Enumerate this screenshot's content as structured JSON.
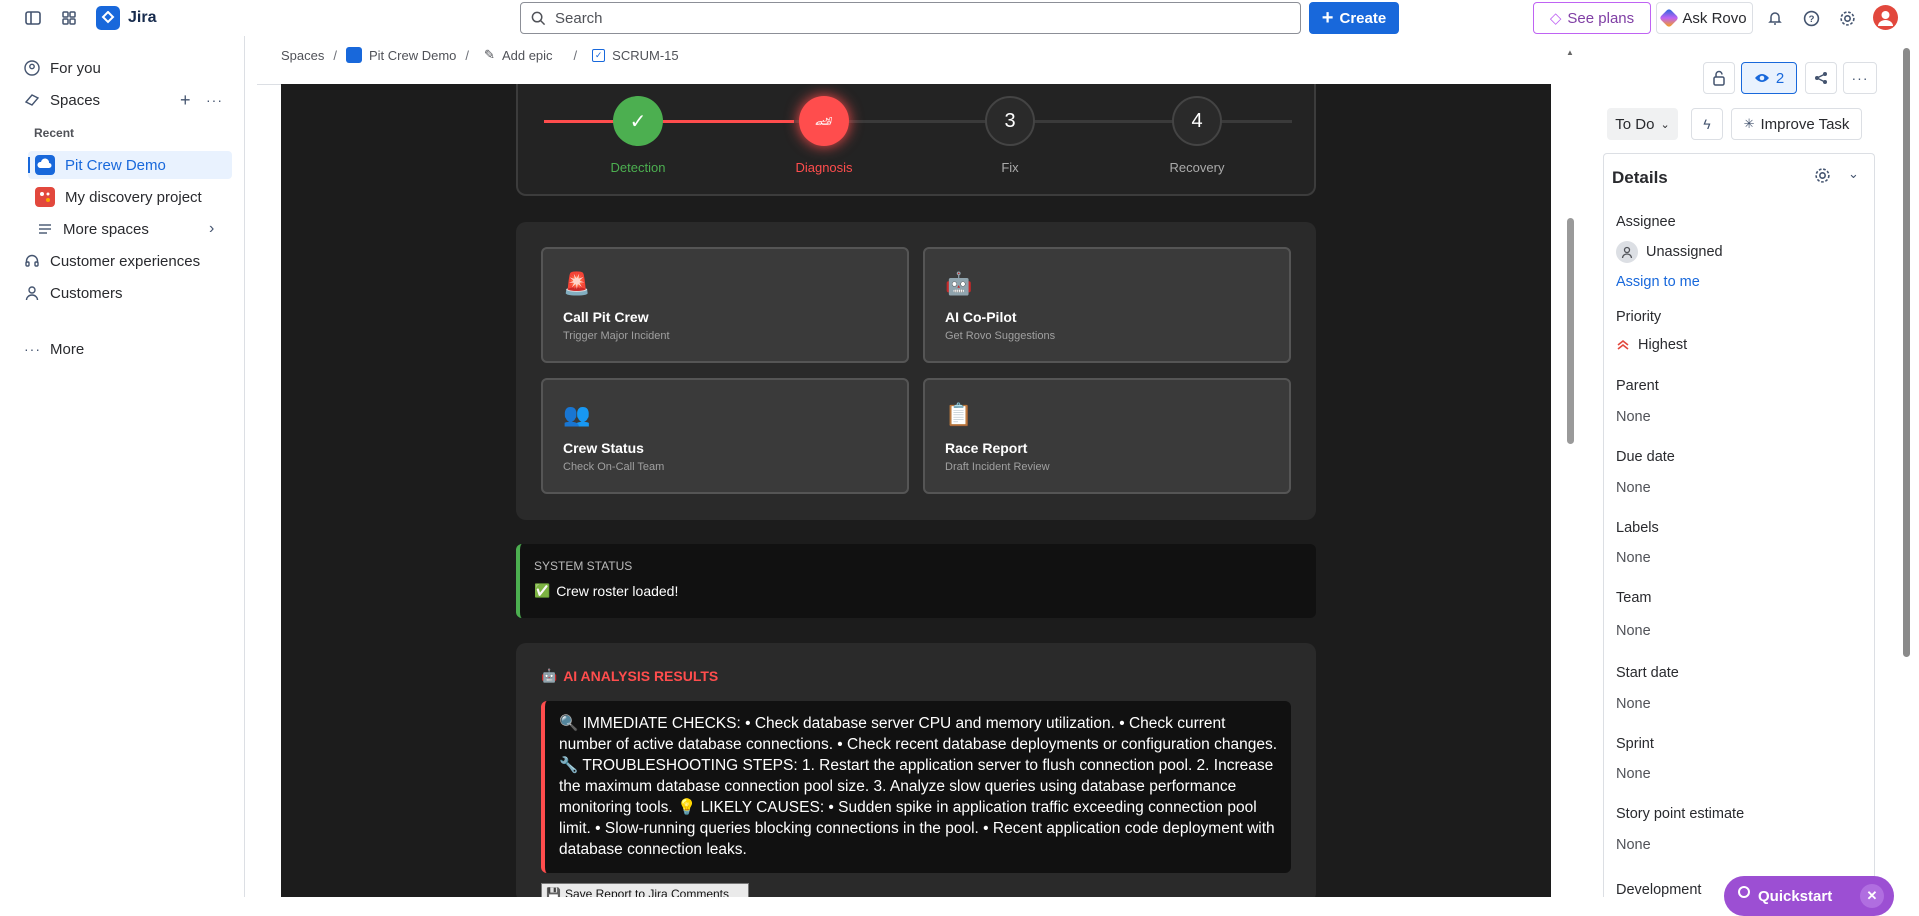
{
  "topnav": {
    "app_name": "Jira",
    "search_placeholder": "Search",
    "create_label": "Create",
    "see_plans_label": "See plans",
    "ask_rovo_label": "Ask Rovo",
    "icons": [
      "sidebar-toggle-icon",
      "app-switcher-icon",
      "bell-icon",
      "help-icon",
      "settings-icon"
    ]
  },
  "sidebar": {
    "for_you": "For you",
    "spaces": "Spaces",
    "recent": "Recent",
    "projects": [
      {
        "label": "Pit Crew Demo",
        "color": "#1868db",
        "selected": true
      },
      {
        "label": "My discovery project",
        "color": "#e2483d",
        "selected": false
      }
    ],
    "more_spaces": "More spaces",
    "customer_experiences": "Customer experiences",
    "customers": "Customers",
    "more": "More"
  },
  "breadcrumb": {
    "spaces": "Spaces",
    "project": "Pit Crew Demo",
    "add_epic": "Add epic",
    "issue_key": "SCRUM-15"
  },
  "app": {
    "steps": [
      {
        "label": "Detection",
        "symbol": "✓",
        "state": "done",
        "color": "#4caf50"
      },
      {
        "label": "Diagnosis",
        "symbol": "🏎",
        "state": "active",
        "color": "#ff4d4d"
      },
      {
        "label": "Fix",
        "symbol": "3",
        "state": "todo",
        "color": "#aaaaaa"
      },
      {
        "label": "Recovery",
        "symbol": "4",
        "state": "todo",
        "color": "#aaaaaa"
      }
    ],
    "tiles": [
      {
        "icon": "🚨",
        "title": "Call Pit Crew",
        "subtitle": "Trigger Major Incident"
      },
      {
        "icon": "🤖",
        "title": "AI Co-Pilot",
        "subtitle": "Get Rovo Suggestions"
      },
      {
        "icon": "👥",
        "title": "Crew Status",
        "subtitle": "Check On-Call Team"
      },
      {
        "icon": "📋",
        "title": "Race Report",
        "subtitle": "Draft Incident Review"
      }
    ],
    "status": {
      "heading": "SYSTEM STATUS",
      "icon": "✅",
      "message": "Crew roster loaded!"
    },
    "ai": {
      "icon": "🤖",
      "heading": "AI ANALYSIS RESULTS",
      "text": "🔍 IMMEDIATE CHECKS: • Check database server CPU and memory utilization. • Check current number of active database connections. • Check recent database deployments or configuration changes. 🔧 TROUBLESHOOTING STEPS: 1. Restart the application server to flush connection pool. 2. Increase the maximum database connection pool size. 3. Analyze slow queries using database performance monitoring tools. 💡 LIKELY CAUSES: • Sudden spike in application traffic exceeding connection pool limit. • Slow-running queries blocking connections in the pool. • Recent application code deployment with database connection leaks.",
      "save_button": "Save Report to Jira Comments",
      "save_icon": "💾"
    }
  },
  "right_panel": {
    "watchers_count": "2",
    "status_label": "To Do",
    "improve_task_label": "Improve Task",
    "details_title": "Details",
    "assignee_label": "Assignee",
    "assignee_value": "Unassigned",
    "assign_to_me": "Assign to me",
    "priority_label": "Priority",
    "priority_value": "Highest",
    "parent_label": "Parent",
    "parent_value": "None",
    "due_date_label": "Due date",
    "due_date_value": "None",
    "labels_label": "Labels",
    "labels_value": "None",
    "team_label": "Team",
    "team_value": "None",
    "start_date_label": "Start date",
    "start_date_value": "None",
    "sprint_label": "Sprint",
    "sprint_value": "None",
    "story_point_label": "Story point estimate",
    "story_point_value": "None",
    "development_label": "Development",
    "quickstart_label": "Quickstart"
  }
}
